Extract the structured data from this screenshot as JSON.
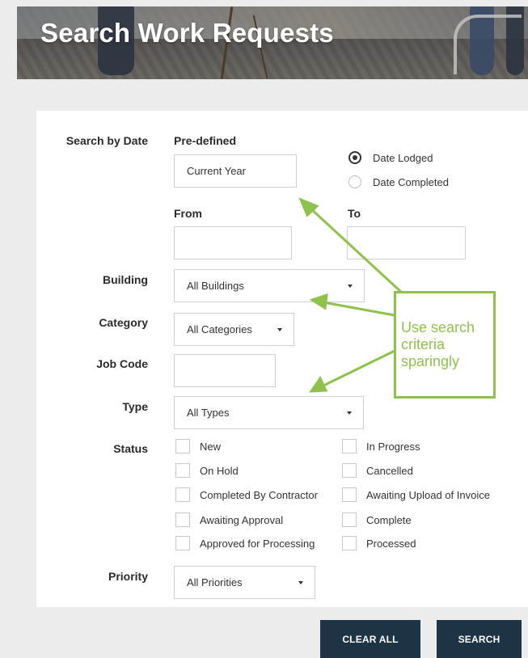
{
  "header": {
    "title": "Search Work Requests"
  },
  "form": {
    "search_by_date_label": "Search by Date",
    "predefined_label": "Pre-defined",
    "predefined_value": "Current Year",
    "date_type_options": [
      {
        "label": "Date Lodged",
        "selected": true
      },
      {
        "label": "Date Completed",
        "selected": false
      }
    ],
    "from_label": "From",
    "from_value": "",
    "to_label": "To",
    "to_value": "",
    "building_label": "Building",
    "building_value": "All Buildings",
    "category_label": "Category",
    "category_value": "All Categories",
    "job_code_label": "Job Code",
    "job_code_value": "",
    "type_label": "Type",
    "type_value": "All Types",
    "status_label": "Status",
    "status_options": [
      {
        "label": "New",
        "checked": false
      },
      {
        "label": "In Progress",
        "checked": false
      },
      {
        "label": "On Hold",
        "checked": false
      },
      {
        "label": "Cancelled",
        "checked": false
      },
      {
        "label": "Completed By Contractor",
        "checked": false
      },
      {
        "label": "Awaiting Upload of Invoice",
        "checked": false
      },
      {
        "label": "Awaiting Approval",
        "checked": false
      },
      {
        "label": "Complete",
        "checked": false
      },
      {
        "label": "Approved for Processing",
        "checked": false
      },
      {
        "label": "Processed",
        "checked": false
      }
    ],
    "priority_label": "Priority",
    "priority_value": "All Priorities"
  },
  "actions": {
    "clear_label": "CLEAR ALL",
    "search_label": "SEARCH"
  },
  "annotation": {
    "text": "Use search criteria sparingly",
    "color": "#8fc24d"
  },
  "colors": {
    "button_bg": "#1d3346",
    "page_bg": "#ececec"
  }
}
